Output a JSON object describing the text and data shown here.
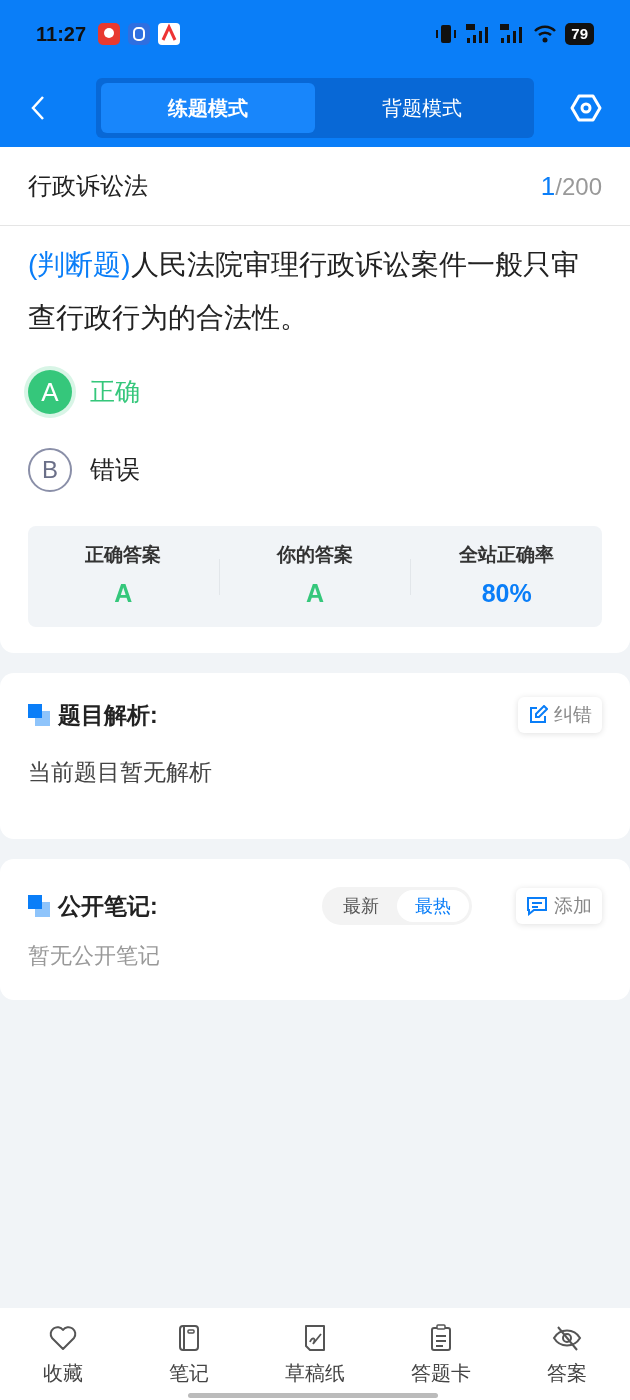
{
  "status_bar": {
    "time": "11:27",
    "battery": "79"
  },
  "nav": {
    "tabs": [
      {
        "label": "练题模式",
        "selected": true
      },
      {
        "label": "背题模式",
        "selected": false
      }
    ]
  },
  "subject": {
    "title": "行政诉讼法",
    "current": "1",
    "separator": "/",
    "total": "200"
  },
  "question": {
    "type_tag": "(判断题)",
    "text": "人民法院审理行政诉讼案件一般只审查行政行为的合法性。"
  },
  "options": [
    {
      "letter": "A",
      "text": "正确",
      "selected": true
    },
    {
      "letter": "B",
      "text": "错误",
      "selected": false
    }
  ],
  "stats": [
    {
      "label": "正确答案",
      "value": "A",
      "kind": "answer"
    },
    {
      "label": "你的答案",
      "value": "A",
      "kind": "answer"
    },
    {
      "label": "全站正确率",
      "value": "80%",
      "kind": "rate"
    }
  ],
  "analysis": {
    "title": "题目解析:",
    "action": "纠错",
    "body": "当前题目暂无解析"
  },
  "notes": {
    "title": "公开笔记:",
    "sort_tabs": [
      {
        "label": "最新",
        "selected": false
      },
      {
        "label": "最热",
        "selected": true
      }
    ],
    "action": "添加",
    "empty": "暂无公开笔记"
  },
  "bottom_nav": [
    {
      "label": "收藏",
      "kind": "heart"
    },
    {
      "label": "笔记",
      "kind": "notebook"
    },
    {
      "label": "草稿纸",
      "kind": "draft"
    },
    {
      "label": "答题卡",
      "kind": "card"
    },
    {
      "label": "答案",
      "kind": "eye"
    }
  ]
}
